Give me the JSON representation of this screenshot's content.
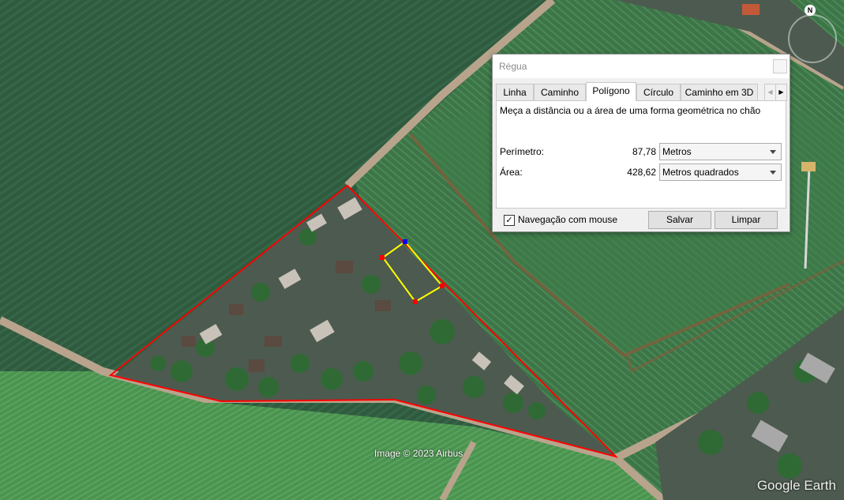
{
  "map": {
    "attribution": "Image © 2023 Airbus",
    "brand": "Google Earth",
    "compass_label": "N"
  },
  "dialog": {
    "title": "Régua",
    "tabs": [
      "Linha",
      "Caminho",
      "Polígono",
      "Círculo",
      "Caminho em 3D"
    ],
    "active_tab": "Polígono",
    "description": "Meça a distância ou a área de uma forma geométrica no chão",
    "perimeter": {
      "label": "Perímetro:",
      "value": "87,78",
      "unit": "Metros"
    },
    "area": {
      "label": "Área:",
      "value": "428,62",
      "unit": "Metros quadrados"
    },
    "mouse_nav": {
      "label": "Navegação com mouse",
      "checked": true,
      "mark": "✓"
    },
    "save_label": "Salvar",
    "clear_label": "Limpar"
  },
  "colors": {
    "outer_polygon": "#ff0000",
    "measure_polygon": "#ffff00",
    "vertex_red": "#ff0000",
    "vertex_blue": "#0000ff"
  }
}
